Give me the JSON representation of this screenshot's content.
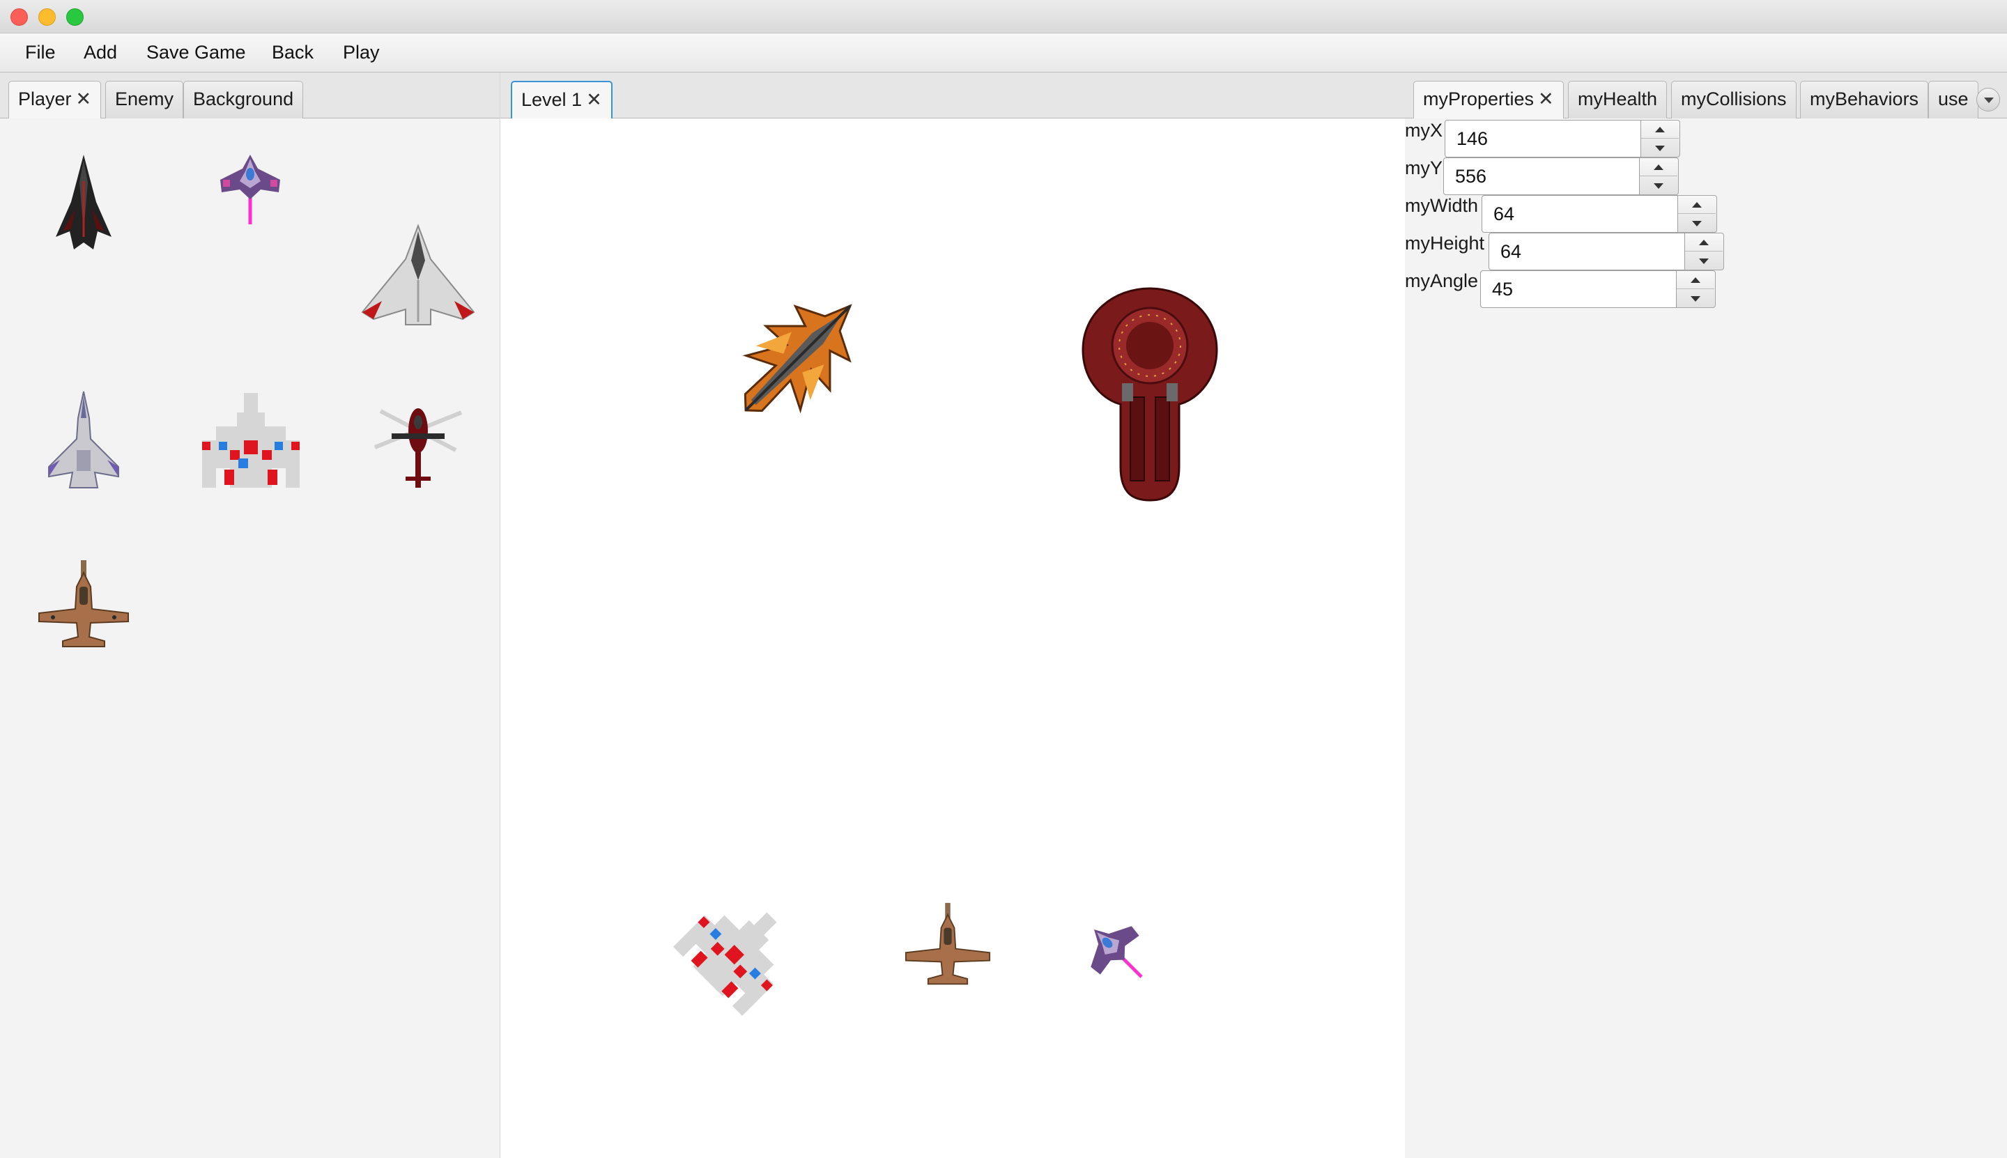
{
  "window": {
    "title": ""
  },
  "menu": {
    "items": [
      {
        "label": "File"
      },
      {
        "label": "Add"
      },
      {
        "label": "Save Game"
      },
      {
        "label": "Back"
      },
      {
        "label": "Play"
      }
    ]
  },
  "left_panel": {
    "tabs": [
      {
        "label": "Player",
        "closable": true,
        "active": true
      },
      {
        "label": "Enemy"
      },
      {
        "label": "Background"
      }
    ],
    "sprites": [
      {
        "name": "dark-stealth-jet-icon"
      },
      {
        "name": "purple-fighter-icon"
      },
      {
        "name": "white-red-delta-jet-icon"
      },
      {
        "name": "grey-purple-fighter-jet-icon"
      },
      {
        "name": "pixel-galaga-ship-icon"
      },
      {
        "name": "red-helicopter-icon"
      },
      {
        "name": "brown-camo-jet-icon"
      }
    ]
  },
  "center_panel": {
    "tabs": [
      {
        "label": "Level 1",
        "closable": true,
        "active": true
      }
    ],
    "canvas_sprites": [
      {
        "name": "orange-flame-ship-icon"
      },
      {
        "name": "red-mothership-icon"
      },
      {
        "name": "pixel-galaga-ship-rotated-icon"
      },
      {
        "name": "brown-camo-jet-icon"
      },
      {
        "name": "purple-fighter-rotated-icon"
      }
    ]
  },
  "right_panel": {
    "tabs": [
      {
        "label": "myProperties",
        "closable": true,
        "active": true
      },
      {
        "label": "myHealth"
      },
      {
        "label": "myCollisions"
      },
      {
        "label": "myBehaviors"
      },
      {
        "label": "use"
      }
    ],
    "overflow_icon": "chevron-down-icon",
    "properties": [
      {
        "label": "myX",
        "value": "146"
      },
      {
        "label": "myY",
        "value": "556"
      },
      {
        "label": "myWidth",
        "value": "64"
      },
      {
        "label": "myHeight",
        "value": "64"
      },
      {
        "label": "myAngle",
        "value": "45"
      }
    ]
  },
  "colors": {
    "focus_accent": "#3a93d6",
    "close_button": "#fc5f57",
    "minimize_button": "#fdbc2e",
    "maximize_button": "#28c840"
  }
}
